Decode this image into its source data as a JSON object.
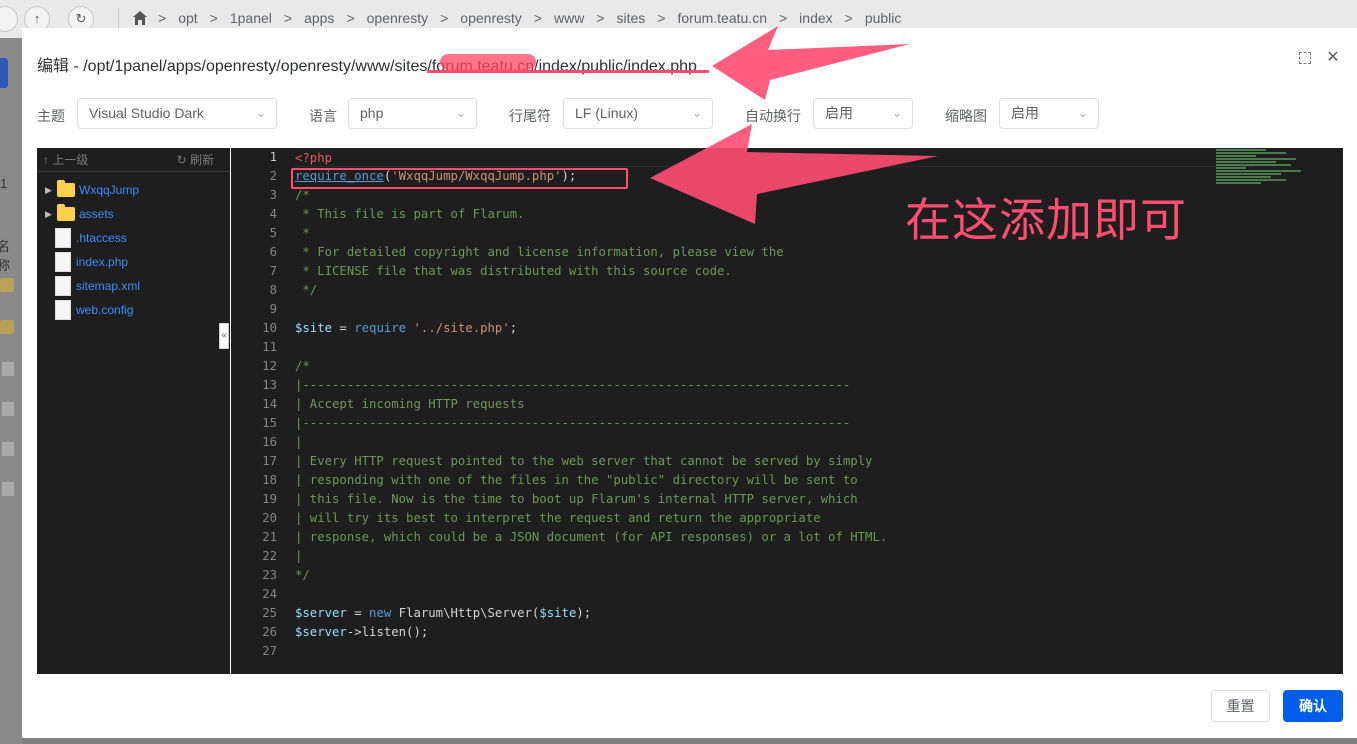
{
  "background": {
    "path": [
      "opt",
      "1panel",
      "apps",
      "openresty",
      "openresty",
      "www",
      "sites",
      "forum.teatu.cn",
      "index",
      "public"
    ],
    "back_icon": "up-arrow-icon",
    "refresh_icon": "refresh-icon",
    "left_letters": [
      "名称",
      "1"
    ]
  },
  "dialog": {
    "title": "编辑 - /opt/1panel/apps/openresty/openresty/www/sites/forum.teatu.cn/index/public/index.php",
    "toolbar": {
      "theme_label": "主题",
      "theme_value": "Visual Studio Dark",
      "language_label": "语言",
      "language_value": "php",
      "eol_label": "行尾符",
      "eol_value": "LF (Linux)",
      "wrap_label": "自动换行",
      "wrap_value": "启用",
      "minimap_label": "缩略图",
      "minimap_value": "启用"
    },
    "tree": {
      "up_label": "上一级",
      "refresh_label": "刷新",
      "items": [
        {
          "name": "WxqqJump",
          "type": "folder"
        },
        {
          "name": "assets",
          "type": "folder"
        },
        {
          "name": ".htaccess",
          "type": "file"
        },
        {
          "name": "index.php",
          "type": "file"
        },
        {
          "name": "sitemap.xml",
          "type": "file"
        },
        {
          "name": "web.config",
          "type": "file"
        }
      ]
    },
    "editor": {
      "line_numbers": [
        "1",
        "2",
        "3",
        "4",
        "5",
        "6",
        "7",
        "8",
        "9",
        "10",
        "11",
        "12",
        "13",
        "14",
        "15",
        "16",
        "17",
        "18",
        "19",
        "20",
        "21",
        "22",
        "23",
        "24",
        "25",
        "26",
        "27"
      ],
      "lines": [
        "<?php",
        "require_once('WxqqJump/WxqqJump.php');",
        "/*",
        " * This file is part of Flarum.",
        " *",
        " * For detailed copyright and license information, please view the",
        " * LICENSE file that was distributed with this source code.",
        " */",
        "",
        "$site = require '../site.php';",
        "",
        "/*",
        "|--------------------------------------------------------------------------",
        "| Accept incoming HTTP requests",
        "|--------------------------------------------------------------------------",
        "|",
        "| Every HTTP request pointed to the web server that cannot be served by simply",
        "| responding with one of the files in the \"public\" directory will be sent to",
        "| this file. Now is the time to boot up Flarum's internal HTTP server, which",
        "| will try its best to interpret the request and return the appropriate",
        "| response, which could be a JSON document (for API responses) or a lot of HTML.",
        "|",
        "*/",
        "",
        "$server = new Flarum\\Http\\Server($site);",
        "$server->listen();",
        ""
      ]
    },
    "annotation": "在这添加即可",
    "buttons": {
      "reset": "重置",
      "confirm": "确认"
    },
    "icons": [
      "fullscreen-icon",
      "close-icon"
    ]
  },
  "colors": {
    "accent": "#005eeb",
    "annotation": "#ff4d72",
    "editor_bg": "#1e1e1e"
  }
}
